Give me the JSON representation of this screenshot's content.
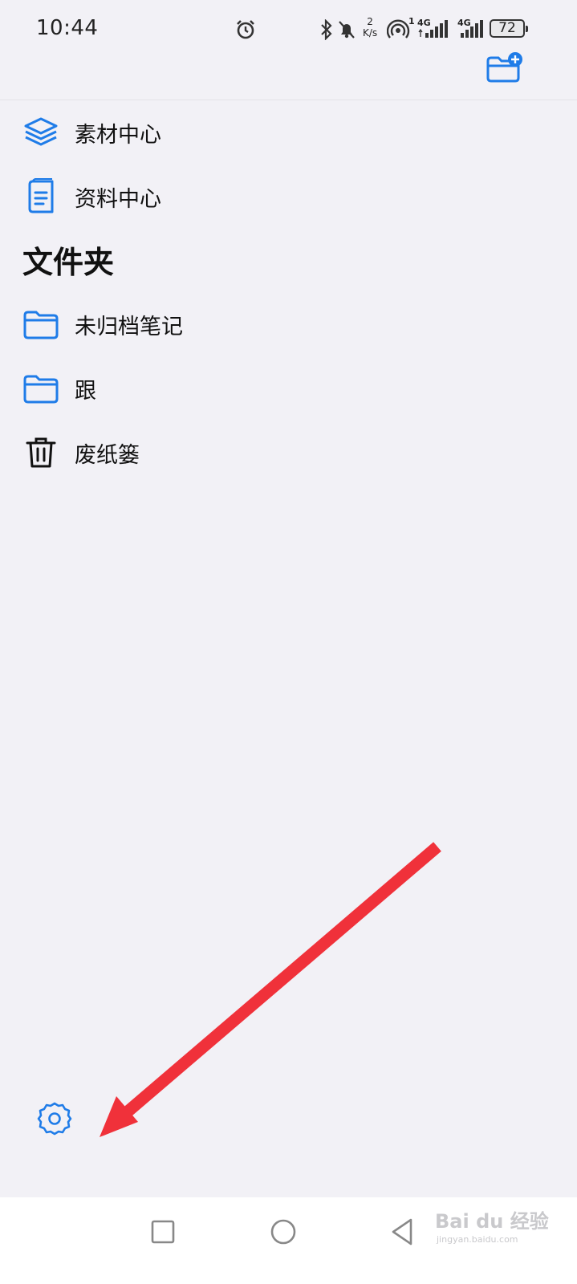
{
  "status_bar": {
    "time": "10:44",
    "speed_value": "2",
    "speed_unit": "K/s",
    "hotspot_count": "1",
    "signal_1_label": "4G",
    "signal_2_label": "4G",
    "battery": "72",
    "icons": [
      "alarm-icon",
      "bluetooth-icon",
      "mute-icon",
      "hotspot-icon",
      "signal-icon",
      "signal-icon",
      "battery-icon"
    ]
  },
  "header": {
    "new_folder_icon": "folder-plus-icon"
  },
  "menu": {
    "items": [
      {
        "label": "素材中心",
        "icon": "layers-icon"
      },
      {
        "label": "资料中心",
        "icon": "document-icon"
      }
    ]
  },
  "folders": {
    "title": "文件夹",
    "items": [
      {
        "label": "未归档笔记",
        "icon": "folder-icon"
      },
      {
        "label": "跟",
        "icon": "folder-icon"
      },
      {
        "label": "废纸篓",
        "icon": "trash-icon"
      }
    ]
  },
  "footer": {
    "settings_icon": "gear-icon"
  },
  "nav_bar": {
    "icons": [
      "recents-square-icon",
      "home-circle-icon",
      "back-triangle-icon"
    ]
  },
  "watermark": {
    "main": "Bai du 经验",
    "sub": "jingyan.baidu.com"
  },
  "colors": {
    "accent": "#1f7ce8",
    "background": "#f2f1f6",
    "annotation_arrow": "#f0313a"
  }
}
